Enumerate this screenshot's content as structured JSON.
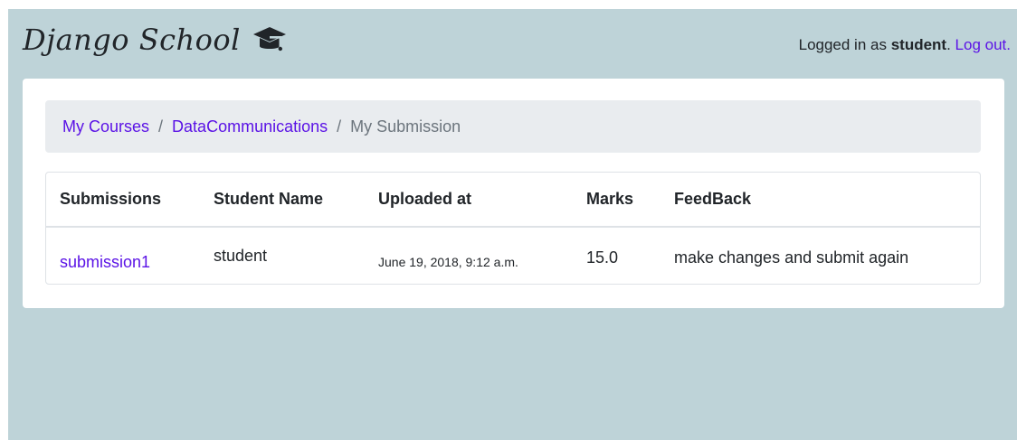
{
  "header": {
    "brand": "Django School",
    "brand_icon": "graduation-cap-icon",
    "login_prefix": "Logged in as ",
    "username": "student",
    "login_suffix": ". ",
    "logout_label": "Log out."
  },
  "breadcrumb": {
    "items": [
      {
        "label": "My Courses",
        "link": true
      },
      {
        "label": "DataCommunications",
        "link": true
      },
      {
        "label": "My Submission",
        "link": false
      }
    ],
    "separator": "/"
  },
  "table": {
    "columns": [
      "Submissions",
      "Student Name",
      "Uploaded at",
      "Marks",
      "FeedBack"
    ],
    "rows": [
      {
        "submission": "submission1",
        "student_name": "student",
        "uploaded_at": "June 19, 2018, 9:12 a.m.",
        "marks": "15.0",
        "feedback": "make changes and submit again"
      }
    ]
  },
  "colors": {
    "background": "#bed3d8",
    "link": "#5b13e6",
    "breadcrumb_bg": "#e9ecef",
    "text": "#212529",
    "muted": "#6c757d"
  }
}
